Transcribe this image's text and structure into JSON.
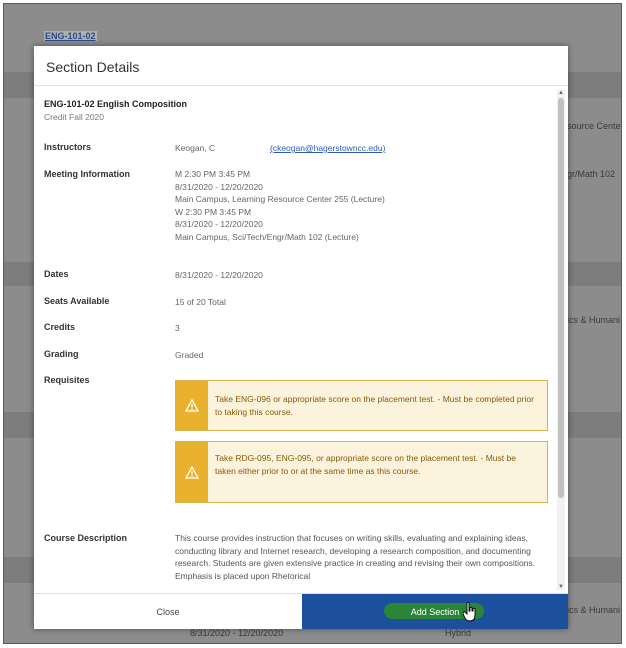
{
  "background": {
    "link": "ENG-101-02",
    "right_texts": [
      "source Cente",
      "gr/Math 102",
      "ics & Humani",
      "ics & Humani"
    ],
    "bottom_date": "8/31/2020 - 12/20/2020",
    "bottom_mode": "Hybrid"
  },
  "modal": {
    "title": "Section Details",
    "course_title": "ENG-101-02 English Composition",
    "term": "Credit Fall 2020",
    "instructors_label": "Instructors",
    "instructor_name": "Keogan, C",
    "instructor_email": "(ckeogan@hagerstowncc.edu)",
    "meeting_label": "Meeting Information",
    "meeting_lines": [
      "M 2:30 PM 3:45 PM",
      "8/31/2020 - 12/20/2020",
      "Main Campus, Learning Resource Center 255 (Lecture)",
      "W 2:30 PM 3:45 PM",
      "8/31/2020 - 12/20/2020",
      "Main Campus, Sci/Tech/Engr/Math 102 (Lecture)"
    ],
    "dates_label": "Dates",
    "dates_value": "8/31/2020 - 12/20/2020",
    "seats_label": "Seats Available",
    "seats_value": "15 of 20 Total",
    "credits_label": "Credits",
    "credits_value": "3",
    "grading_label": "Grading",
    "grading_value": "Graded",
    "requisites_label": "Requisites",
    "requisites": [
      "Take ENG-096 or appropriate score on the placement test.  - Must be completed prior to taking this course.",
      "Take RDG-095, ENG-095, or appropriate score on the placement test.  - Must be taken either prior to or at the same time as this course."
    ],
    "description_label": "Course Description",
    "description": "This course provides instruction that focuses on writing skills, evaluating and explaining ideas, conducting library and Internet research, developing a research composition, and documenting research. Students are given extensive practice in creating and revising their own compositions. Emphasis is placed upon Rhetorical",
    "close_label": "Close",
    "add_label": "Add Section"
  },
  "colors": {
    "primary_button": "#1c4f9c",
    "warning_bg": "#fbf3dc",
    "warning_border": "#d9b24c",
    "warning_icon_bg": "#e8b12e",
    "highlight": "#2e8b2e"
  }
}
